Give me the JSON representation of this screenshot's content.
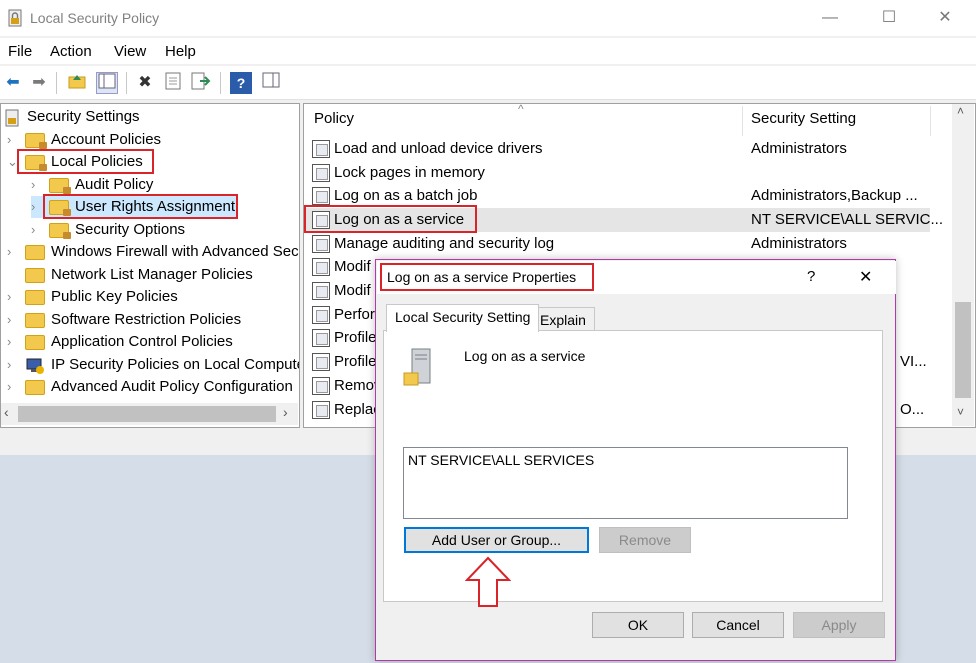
{
  "window": {
    "title": "Local Security Policy"
  },
  "menu": [
    "File",
    "Action",
    "View",
    "Help"
  ],
  "tree": {
    "root": "Security Settings",
    "items": [
      "Account Policies",
      "Local Policies",
      "Audit Policy",
      "User Rights Assignment",
      "Security Options",
      "Windows Firewall with Advanced Security",
      "Network List Manager Policies",
      "Public Key Policies",
      "Software Restriction Policies",
      "Application Control Policies",
      "IP Security Policies on Local Computer",
      "Advanced Audit Policy Configuration"
    ]
  },
  "list": {
    "col_policy": "Policy",
    "col_setting": "Security Setting",
    "rows": [
      {
        "policy": "Load and unload device drivers",
        "setting": "Administrators"
      },
      {
        "policy": "Lock pages in memory",
        "setting": ""
      },
      {
        "policy": "Log on as a batch job",
        "setting": "Administrators,Backup ..."
      },
      {
        "policy": "Log on as a service",
        "setting": "NT SERVICE\\ALL SERVIC..."
      },
      {
        "policy": "Manage auditing and security log",
        "setting": "Administrators"
      },
      {
        "policy": "Modif",
        "setting": ""
      },
      {
        "policy": "Modif",
        "setting": ""
      },
      {
        "policy": "Perfor",
        "setting": ""
      },
      {
        "policy": "Profile",
        "setting": ""
      },
      {
        "policy": "Profile",
        "setting": "VI..."
      },
      {
        "policy": "Remov",
        "setting": ""
      },
      {
        "policy": "Replac",
        "setting": "O..."
      }
    ]
  },
  "dialog": {
    "title": "Log on as a service Properties",
    "help": "?",
    "close": "✕",
    "tabs": [
      "Local Security Setting",
      "Explain"
    ],
    "policy_name": "Log on as a service",
    "members": [
      "NT SERVICE\\ALL SERVICES"
    ],
    "add_button": "Add User or Group...",
    "remove_button": "Remove",
    "ok": "OK",
    "cancel": "Cancel",
    "apply": "Apply"
  },
  "colors": {
    "highlight": "#d9252a",
    "selection": "#e5e5e5",
    "accent": "#0078d7"
  }
}
